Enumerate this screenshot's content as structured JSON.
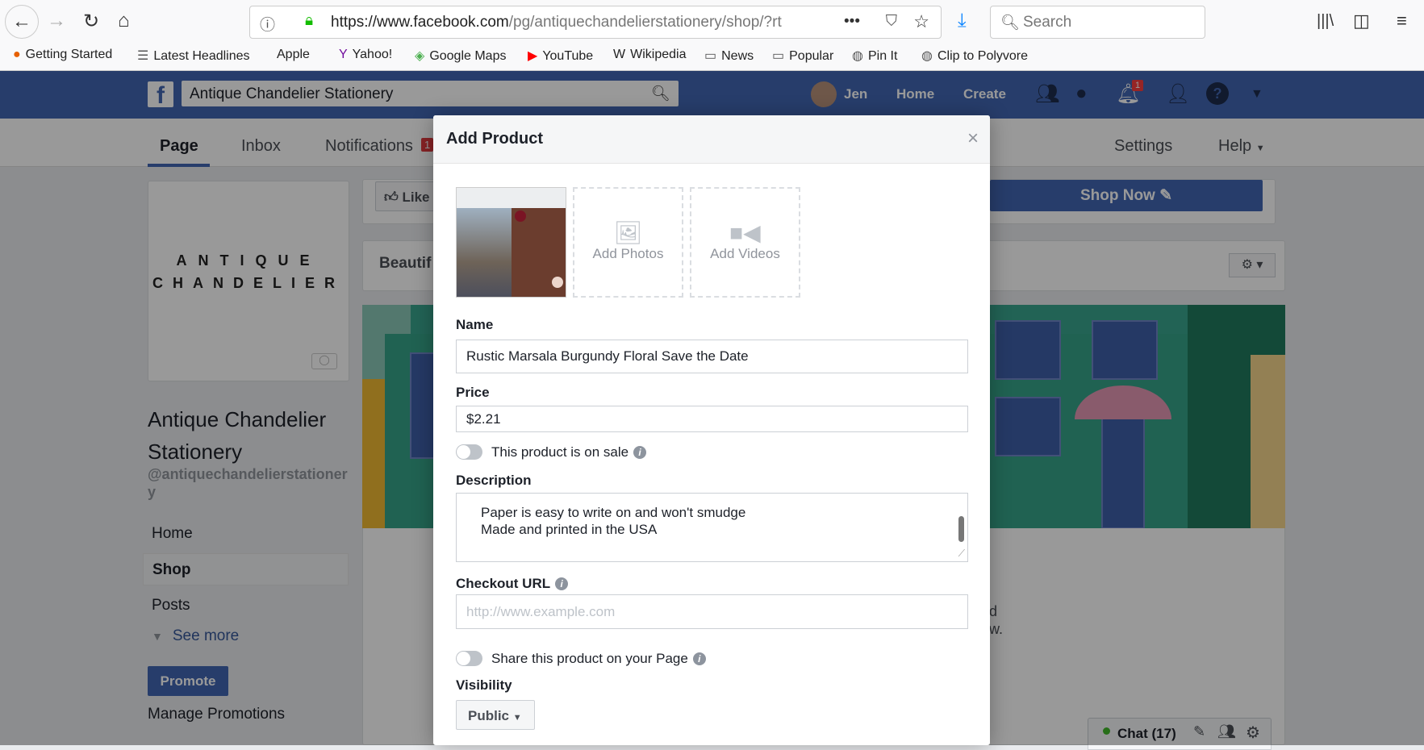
{
  "browser": {
    "url_host": "https://www.facebook.com",
    "url_path": "/pg/antiquechandelierstationery/shop/?rt",
    "search_placeholder": "Search",
    "bookmarks": [
      "Getting Started",
      "Latest Headlines",
      "Apple",
      "Yahoo!",
      "Google Maps",
      "YouTube",
      "Wikipedia",
      "News",
      "Popular",
      "Pin It",
      "Clip to Polyvore"
    ]
  },
  "fb": {
    "search_value": "Antique Chandelier Stationery",
    "user": "Jen",
    "home": "Home",
    "create": "Create",
    "notif_count": "1"
  },
  "page_tabs": {
    "page": "Page",
    "inbox": "Inbox",
    "notifications": "Notifications",
    "notifications_count": "1",
    "settings": "Settings",
    "help": "Help"
  },
  "sidebar": {
    "logo_line1": "ANTIQUE",
    "logo_line2": "CHANDELIER",
    "page_name": "Antique Chandelier Stationery",
    "handle": "@antiquechandelierstationery",
    "items": [
      "Home",
      "Shop",
      "Posts"
    ],
    "see_more": "See more",
    "promote": "Promote",
    "manage_promotions": "Manage Promotions"
  },
  "main": {
    "like": "Like",
    "shop_now": "Shop Now",
    "section_title": "Beautif",
    "partial_text_1": "d",
    "partial_text_2": "w."
  },
  "chat": {
    "label": "Chat (17)"
  },
  "modal": {
    "title": "Add Product",
    "add_photos": "Add Photos",
    "add_videos": "Add Videos",
    "name_label": "Name",
    "name_value": "Rustic Marsala Burgundy Floral Save the Date",
    "price_label": "Price",
    "price_value": "$2.21",
    "on_sale_label": "This product is on sale",
    "on_sale": false,
    "description_label": "Description",
    "description_lines": [
      "Paper is easy to write on and won't smudge",
      "Made and printed in the USA"
    ],
    "checkout_label": "Checkout URL",
    "checkout_placeholder": "http://www.example.com",
    "share_label": "Share this product on your Page",
    "share": false,
    "visibility_label": "Visibility",
    "visibility_value": "Public"
  }
}
